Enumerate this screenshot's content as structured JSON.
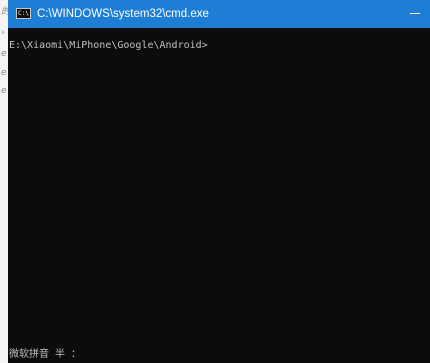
{
  "window": {
    "title": "C:\\WINDOWS\\system32\\cmd.exe",
    "icon_label": "C:\\",
    "accent_color": "#1e7ed6"
  },
  "console": {
    "prompt": "E:\\Xiaomi\\MiPhone\\Google\\Android>",
    "ime_status": "微软拼音 半 ："
  },
  "left_strip": {
    "glyphs": [
      "的",
      "›",
      "e",
      "e",
      "e"
    ]
  }
}
